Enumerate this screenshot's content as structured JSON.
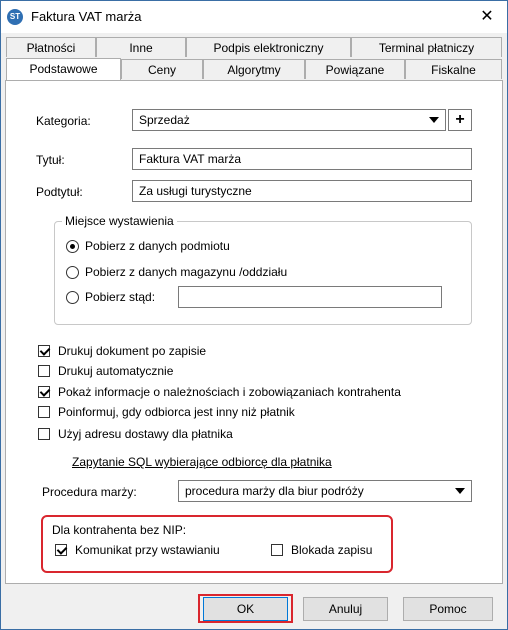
{
  "window": {
    "title": "Faktura VAT marża",
    "icon": "app-icon",
    "close": "✕"
  },
  "tabs_row1": [
    "Płatności",
    "Inne",
    "Podpis elektroniczny",
    "Terminal płatniczy"
  ],
  "tabs_row2": [
    "Podstawowe",
    "Ceny",
    "Algorytmy",
    "Powiązane",
    "Fiskalne"
  ],
  "form": {
    "kategoria_label": "Kategoria:",
    "kategoria_value": "Sprzedaż",
    "plus": "+",
    "tytul_label": "Tytuł:",
    "tytul_value": "Faktura VAT marża",
    "podtytul_label": "Podtytuł:",
    "podtytul_value": "Za usługi turystyczne"
  },
  "miejsce": {
    "title": "Miejsce wystawienia",
    "opt1": "Pobierz z danych podmiotu",
    "opt2": "Pobierz z danych magazynu /oddziału",
    "opt3": "Pobierz stąd:",
    "opt3_value": "",
    "selected": 1
  },
  "checks": [
    {
      "label": "Drukuj dokument po zapisie",
      "checked": true
    },
    {
      "label": "Drukuj automatycznie",
      "checked": false
    },
    {
      "label": "Pokaż informacje o należnościach i zobowiązaniach kontrahenta",
      "checked": true
    },
    {
      "label": "Poinformuj, gdy odbiorca jest inny niż płatnik",
      "checked": false
    },
    {
      "label": "Użyj adresu dostawy dla płatnika",
      "checked": false
    }
  ],
  "sql_link": "Zapytanie SQL wybierające odbiorcę dla płatnika",
  "procedura": {
    "label": "Procedura marży:",
    "value": "procedura marży dla biur podróży"
  },
  "nip": {
    "title": "Dla kontrahenta bez NIP:",
    "komunikat": "Komunikat przy wstawianiu",
    "komunikat_checked": true,
    "blokada": "Blokada zapisu",
    "blokada_checked": false
  },
  "buttons": {
    "ok": "OK",
    "cancel": "Anuluj",
    "help": "Pomoc"
  },
  "colors": {
    "highlight": "#d9262e",
    "accent": "#0078d7"
  }
}
